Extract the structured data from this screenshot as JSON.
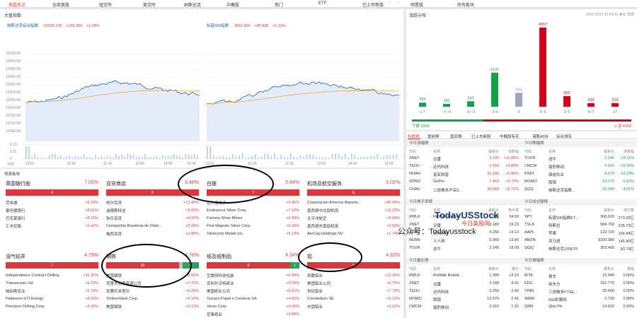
{
  "nav": {
    "items": [
      "美股热点",
      "全部美股",
      "纽交所",
      "美交所",
      "纳斯达克",
      "中概股",
      "热门",
      "ETF",
      "已上市新股",
      "明星股",
      "所有板块"
    ],
    "active": 0
  },
  "indices": {
    "title": "大盘指数",
    "nasdaq": {
      "name": "纳斯达克综合指数",
      "value": "12355.105",
      "change": "+156.369",
      "pct": "+1.28%"
    },
    "sp500": {
      "name": "标普500指数",
      "value": "3662.450",
      "change": "+40.820",
      "pct": "+1.13%"
    },
    "y_ticks": [
      "12550.00",
      "12500.00",
      "12450.00",
      "12400.00",
      "12350.00",
      "12300.00",
      "12250.00",
      "12200.00",
      "12150.00",
      "12100.00",
      "12050.00"
    ],
    "vol_ticks": [
      "4.23",
      "2.11",
      "0"
    ],
    "x_ticks": [
      "12/01",
      "10:30",
      "11:30",
      "13:00",
      "14:00",
      "16:00"
    ],
    "vol_unit": "分时",
    "series_color": "#1e5fc2",
    "avg_color": "#f0a020"
  },
  "distribution": {
    "title": "涨跌分布",
    "timestamp": "2020/12/01 20:59:41 美东 数据",
    "bars": [
      {
        "label": "≤-7",
        "value": 255,
        "color": "#13a14b"
      },
      {
        "label": "-7~-5",
        "value": 181,
        "color": "#13a14b"
      },
      {
        "label": "-5~-3",
        "value": 342,
        "color": "#13a14b"
      },
      {
        "label": "-3~0",
        "value": 2131,
        "color": "#13a14b"
      },
      {
        "label": "0",
        "value": 865,
        "color": "#9aa8b8"
      },
      {
        "label": "0~3",
        "value": 4957,
        "color": "#d0021b"
      },
      {
        "label": "3~5",
        "value": 662,
        "color": "#d0021b"
      },
      {
        "label": "5~7",
        "value": 220,
        "color": "#d0021b"
      },
      {
        "label": "≥7",
        "value": 219,
        "color": "#d0021b"
      }
    ],
    "down_label": "下跌 2909",
    "up_label": "上涨 6058"
  },
  "sectors": {
    "title": "领涨板块",
    "cards": [
      {
        "name": "英国银行股",
        "pct": "7.05%",
        "up": 4,
        "flat": 0,
        "down": 0,
        "rows": [
          [
            "劳埃德",
            "+9.29%"
          ],
          [
            "桑坦德银行",
            "+8.51%"
          ],
          [
            "巴克莱银行",
            "+8.15%"
          ],
          [
            "汇丰控股",
            "+5.41%"
          ]
        ]
      },
      {
        "name": "百货商店",
        "pct": "6.48%",
        "up": 6,
        "flat": 0,
        "down": 0,
        "rows": [
          [
            "柯尔百货",
            "+13.42%"
          ],
          [
            "迪德斯特龙",
            "+5.83%"
          ],
          [
            "狄乐百货",
            "+4.47%"
          ],
          [
            "Companhia Brasileira de Distri...",
            "+2.20%"
          ],
          [
            "梅西百货",
            "+1.86%"
          ]
        ]
      },
      {
        "name": "白银",
        "pct": "5.84%",
        "up": 7,
        "flat": 0,
        "down": 0,
        "rows": [
          [
            "迈力佳电子",
            "+9.45%"
          ],
          [
            "Endeavour Silver Corp.",
            "+7.62%"
          ],
          [
            "Fortuna Silver Mines",
            "+6.58%"
          ],
          [
            "First Majestic Silver Corp.",
            "+6.36%"
          ],
          [
            "Silvercorp Metals Inc.",
            "+5.19%"
          ]
        ]
      },
      {
        "name": "机场及航空服务",
        "pct": "5.02%",
        "up": 6,
        "flat": 0,
        "down": 0,
        "rows": [
          [
            "Corporacion America Airports...",
            "+42.99%"
          ],
          [
            "墨西哥中北部机场",
            "+13.23%"
          ],
          [
            "太平洋航空",
            "+6.33%"
          ],
          [
            "墨西哥东南部机场",
            "+3.55%"
          ],
          [
            "AerCap Holdings NV",
            "+1.74%"
          ]
        ]
      },
      {
        "name": "油气钻井",
        "pct": "4.79%",
        "up": 7,
        "flat": 0,
        "down": 0,
        "rows": [
          [
            "Independence Contract Drilling",
            "+11.36%"
          ],
          [
            "Transocean Ltd.",
            "+9.10%"
          ],
          [
            "纳伯斯实业",
            "+5.19%"
          ],
          [
            "Patterson-UTI Energy",
            "+4.52%"
          ],
          [
            "Precision Drilling Corp.",
            "+4.25%"
          ]
        ]
      },
      {
        "name": "钢铁",
        "pct": "4.76%",
        "up": 18,
        "flat": 1,
        "down": 4,
        "rows": [
          [
            "美国钢铁",
            "+8.55%"
          ],
          [
            "克里夫天然资源公司",
            "+7.72%"
          ],
          [
            "安赛乐米塔尔",
            "+6.99%"
          ],
          [
            "TimkenSteel Corp.",
            "+6.16%"
          ],
          [
            "美国钢铁",
            "+6.13%"
          ]
        ]
      },
      {
        "name": "纸及纸制品",
        "pct": "4.34%",
        "up": 9,
        "flat": 0,
        "down": 1,
        "rows": [
          [
            "互联网科技包装",
            "+6.43%"
          ],
          [
            "克利尔沃特纸业",
            "+5.59%"
          ],
          [
            "美国纸业公司",
            "+5.52%"
          ],
          [
            "Suzano Papel e Celulose SA",
            "+4.56%"
          ],
          [
            "Verso Corp.",
            "+4.06%"
          ],
          [
            "尼泰纸业",
            "+3.88%"
          ]
        ]
      },
      {
        "name": "铝",
        "pct": "4.32%",
        "up": 5,
        "flat": 0,
        "down": 0,
        "rows": [
          [
            "凯撒铝业",
            "+12.30%"
          ],
          [
            "美国铝业公司",
            "+9.70%"
          ],
          [
            "世纪铝业",
            "+7.73%"
          ],
          [
            "Constellium SE",
            "+6.16%"
          ],
          [
            "中国铝业",
            "+0.10%"
          ]
        ]
      }
    ]
  },
  "rank": {
    "tabs": [
      "热度榜",
      "盘前榜",
      "盘后榜",
      "已上市新股",
      "中概股有花",
      "港股ADR",
      "综合排名"
    ],
    "active_tab": 0,
    "blocks": [
      {
        "title": "今日涨幅榜",
        "headers": [
          "代码",
          "名称",
          "最新价",
          "涨跌幅"
        ],
        "rows": [
          [
            "XNET",
            "迅雷",
            "3.180",
            "+10.80%"
          ],
          [
            "TEDU",
            "达内科技",
            "3.250",
            "+9.80%"
          ],
          [
            "NOAH",
            "诺亚财富",
            "31.630",
            "+6.86%"
          ],
          [
            "GPRO",
            "GoPro",
            "7.460",
            "+6.72%"
          ],
          [
            "CHAU",
            "二倍做多沪深3...",
            "39.960",
            "+5.72%"
          ]
        ]
      },
      {
        "title": "今日跌幅榜",
        "headers": [
          "代码",
          "名称",
          "最新价",
          "涨跌幅"
        ],
        "rows": [
          [
            "TOUR",
            "途牛",
            "2.140",
            "-24.11%"
          ],
          [
            "CMCM",
            "猎豹移动",
            "2.010",
            "-15.55%"
          ],
          [
            "KNDI",
            "康迪车业",
            "8.570",
            "-12.19%"
          ],
          [
            "MOMO",
            "陌陌",
            "13.570",
            "-5.63%"
          ],
          [
            "QQQ",
            "纳斯达克指数...",
            "16.990",
            "-4.01%"
          ]
        ]
      },
      {
        "title": "今日换手率榜",
        "headers": [
          "代码",
          "名称",
          "最新价",
          "换手率"
        ],
        "rows": [
          [
            "RWLK",
            "ReWalk Roboti...",
            "1.390",
            "34.59"
          ],
          [
            "XNET",
            "迅雷",
            "3.180",
            "19.23"
          ],
          [
            "TEDU",
            "达内科技",
            "3.250",
            "14.13"
          ],
          [
            "RENN",
            "人人网",
            "5.960",
            "13.80"
          ],
          [
            "TOUR",
            "途牛",
            "2.140",
            "18.09"
          ]
        ]
      },
      {
        "title": "今日成交额榜",
        "headers": [
          "代码",
          "名称",
          "最新价",
          "成交额"
        ],
        "rows": [
          [
            "SPY",
            "标普500指数ET...",
            "366.020",
            "273.02亿"
          ],
          [
            "TSLA",
            "特斯拉",
            "584.760",
            "235.73亿"
          ],
          [
            "AAPL",
            "苹果",
            "122.720",
            "156.94亿"
          ],
          [
            "AMZN",
            "亚马逊",
            "3220.080",
            "145.80亿"
          ],
          [
            "QQQ",
            "纳斯达克100ETF",
            "303.460",
            "83.79亿"
          ]
        ]
      },
      {
        "title": "今日量比榜",
        "headers": [
          "代码",
          "名称",
          "最新价",
          "量比"
        ],
        "rows": [
          [
            "RWLK",
            "ReWalk Roboti...",
            "1.390",
            "14.23"
          ],
          [
            "XNET",
            "迅雷",
            "3.180",
            "4.42"
          ],
          [
            "TEDU",
            "达内科技",
            "3.250",
            "2.66"
          ],
          [
            "MOMO",
            "陌陌",
            "13.570",
            "2.41"
          ],
          [
            "CMCM",
            "猎豹移动",
            "2.010",
            "1.91"
          ]
        ]
      },
      {
        "title": "今日振幅榜",
        "headers": [
          "代码",
          "名称",
          "最新价",
          "振幅"
        ],
        "rows": [
          [
            "BITA",
            "易车",
            "15.940",
            "0.00%"
          ],
          [
            "EDU",
            "新东方",
            "161.770",
            "0.00%"
          ],
          [
            "YINN",
            "三倍做多FTSE...",
            "20.660",
            "0.00%"
          ],
          [
            "WBAI",
            "500彩票网",
            "2.730",
            "0.00%"
          ],
          [
            "QIWI",
            "Qiwi Plc",
            "14.610",
            "0.00%"
          ]
        ]
      }
    ]
  },
  "watermark": {
    "brand": "TodayUSStock",
    "sub": "今日美股网",
    "account": "公众号：Todayusstock"
  }
}
